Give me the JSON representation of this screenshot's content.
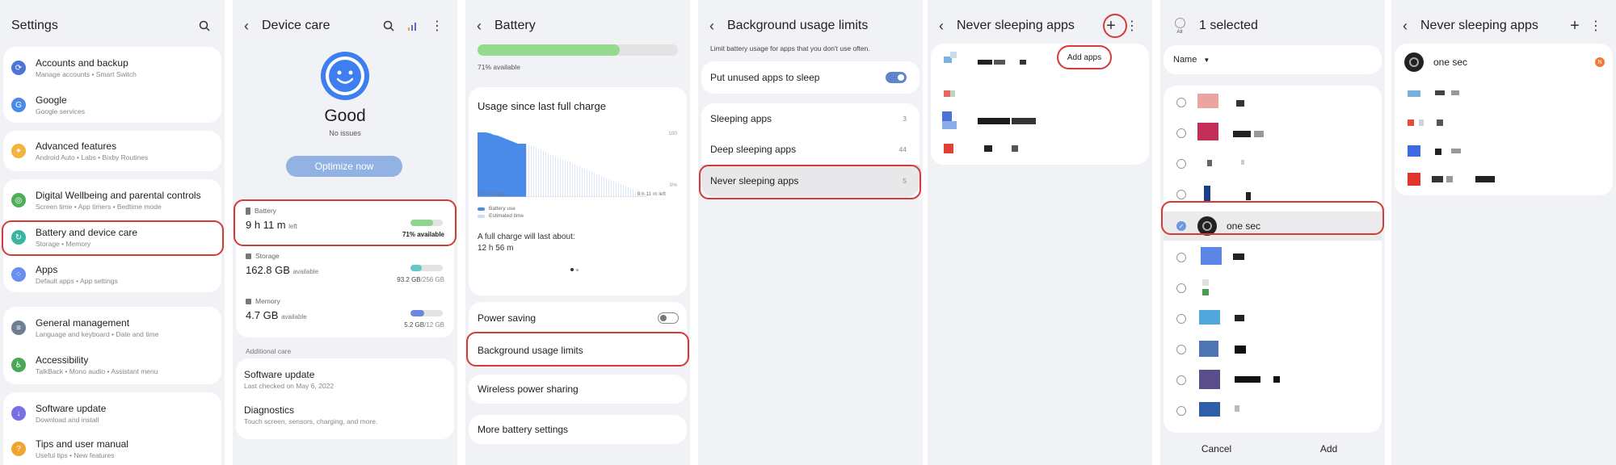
{
  "settings": {
    "title": "Settings",
    "items": [
      {
        "main": "Accounts and backup",
        "sub": "Manage accounts  •  Smart Switch",
        "color": "#4b76d6",
        "glyph": "⟳"
      },
      {
        "main": "Google",
        "sub": "Google services",
        "color": "#4a8ae8",
        "glyph": "G"
      },
      {
        "main": "Advanced features",
        "sub": "Android Auto  •  Labs  •  Bixby Routines",
        "color": "#f3b33d",
        "glyph": "✦"
      },
      {
        "main": "Digital Wellbeing and parental controls",
        "sub": "Screen time  •  App timers  •  Bedtime mode",
        "color": "#4fae5a",
        "glyph": "◎"
      },
      {
        "main": "Battery and device care",
        "sub": "Storage  •  Memory",
        "color": "#3bb4a1",
        "glyph": "↻"
      },
      {
        "main": "Apps",
        "sub": "Default apps  •  App settings",
        "color": "#6c8df2",
        "glyph": "⁘"
      },
      {
        "main": "General management",
        "sub": "Language and keyboard  •  Date and time",
        "color": "#6f7f93",
        "glyph": "≡"
      },
      {
        "main": "Accessibility",
        "sub": "TalkBack  •  Mono audio  •  Assistant menu",
        "color": "#49a957",
        "glyph": "♿"
      },
      {
        "main": "Software update",
        "sub": "Download and install",
        "color": "#7a6ee0",
        "glyph": "↓"
      },
      {
        "main": "Tips and user manual",
        "sub": "Useful tips  •  New features",
        "color": "#f0a52e",
        "glyph": "?"
      }
    ]
  },
  "device_care": {
    "title": "Device care",
    "status": "Good",
    "status_sub": "No issues",
    "optimize_label": "Optimize now",
    "battery": {
      "label": "Battery",
      "value": "9 h 11 m",
      "unit": "left",
      "right": "71% available",
      "level": 0.71
    },
    "storage": {
      "label": "Storage",
      "value": "162.8 GB",
      "unit": "available",
      "used": "93.2 GB",
      "total": "/256 GB",
      "level": 0.36
    },
    "memory": {
      "label": "Memory",
      "value": "4.7 GB",
      "unit": "available",
      "used": "5.2 GB",
      "total": "/12 GB",
      "level": 0.43
    },
    "additional_care": "Additional care",
    "software_update": {
      "main": "Software update",
      "sub": "Last checked on May 6, 2022"
    },
    "diagnostics": {
      "main": "Diagnostics",
      "sub": "Touch screen, sensors, charging, and more."
    }
  },
  "battery": {
    "title": "Battery",
    "available": "71% available",
    "level": 0.71,
    "usage_title": "Usage since last full charge",
    "axis_top": "100",
    "axis_bottom": "0%",
    "time_start": "3 h 4 m ago",
    "time_end": "9 h 11 m left",
    "legend_use": "Battery use",
    "legend_est": "Estimated time",
    "full_charge_label": "A full charge will last about:",
    "full_charge_value": "12 h 56 m",
    "power_saving": "Power saving",
    "background_limits": "Background usage limits",
    "wireless_sharing": "Wireless power sharing",
    "more_settings": "More battery settings"
  },
  "bg_limits": {
    "title": "Background usage limits",
    "desc": "Limit battery usage for apps that you don't use often.",
    "put_unused": "Put unused apps to sleep",
    "sleeping": "Sleeping apps",
    "sleeping_count": "3",
    "deep": "Deep sleeping apps",
    "deep_count": "44",
    "never": "Never sleeping apps",
    "never_count": "5"
  },
  "never1": {
    "title": "Never sleeping apps",
    "tooltip": "Add apps"
  },
  "select": {
    "all": "All",
    "title": "1 selected",
    "sort": "Name",
    "selected_app": "one sec",
    "cancel": "Cancel",
    "add": "Add"
  },
  "never2": {
    "title": "Never sleeping apps",
    "first_app": "one sec",
    "badge": "N"
  }
}
